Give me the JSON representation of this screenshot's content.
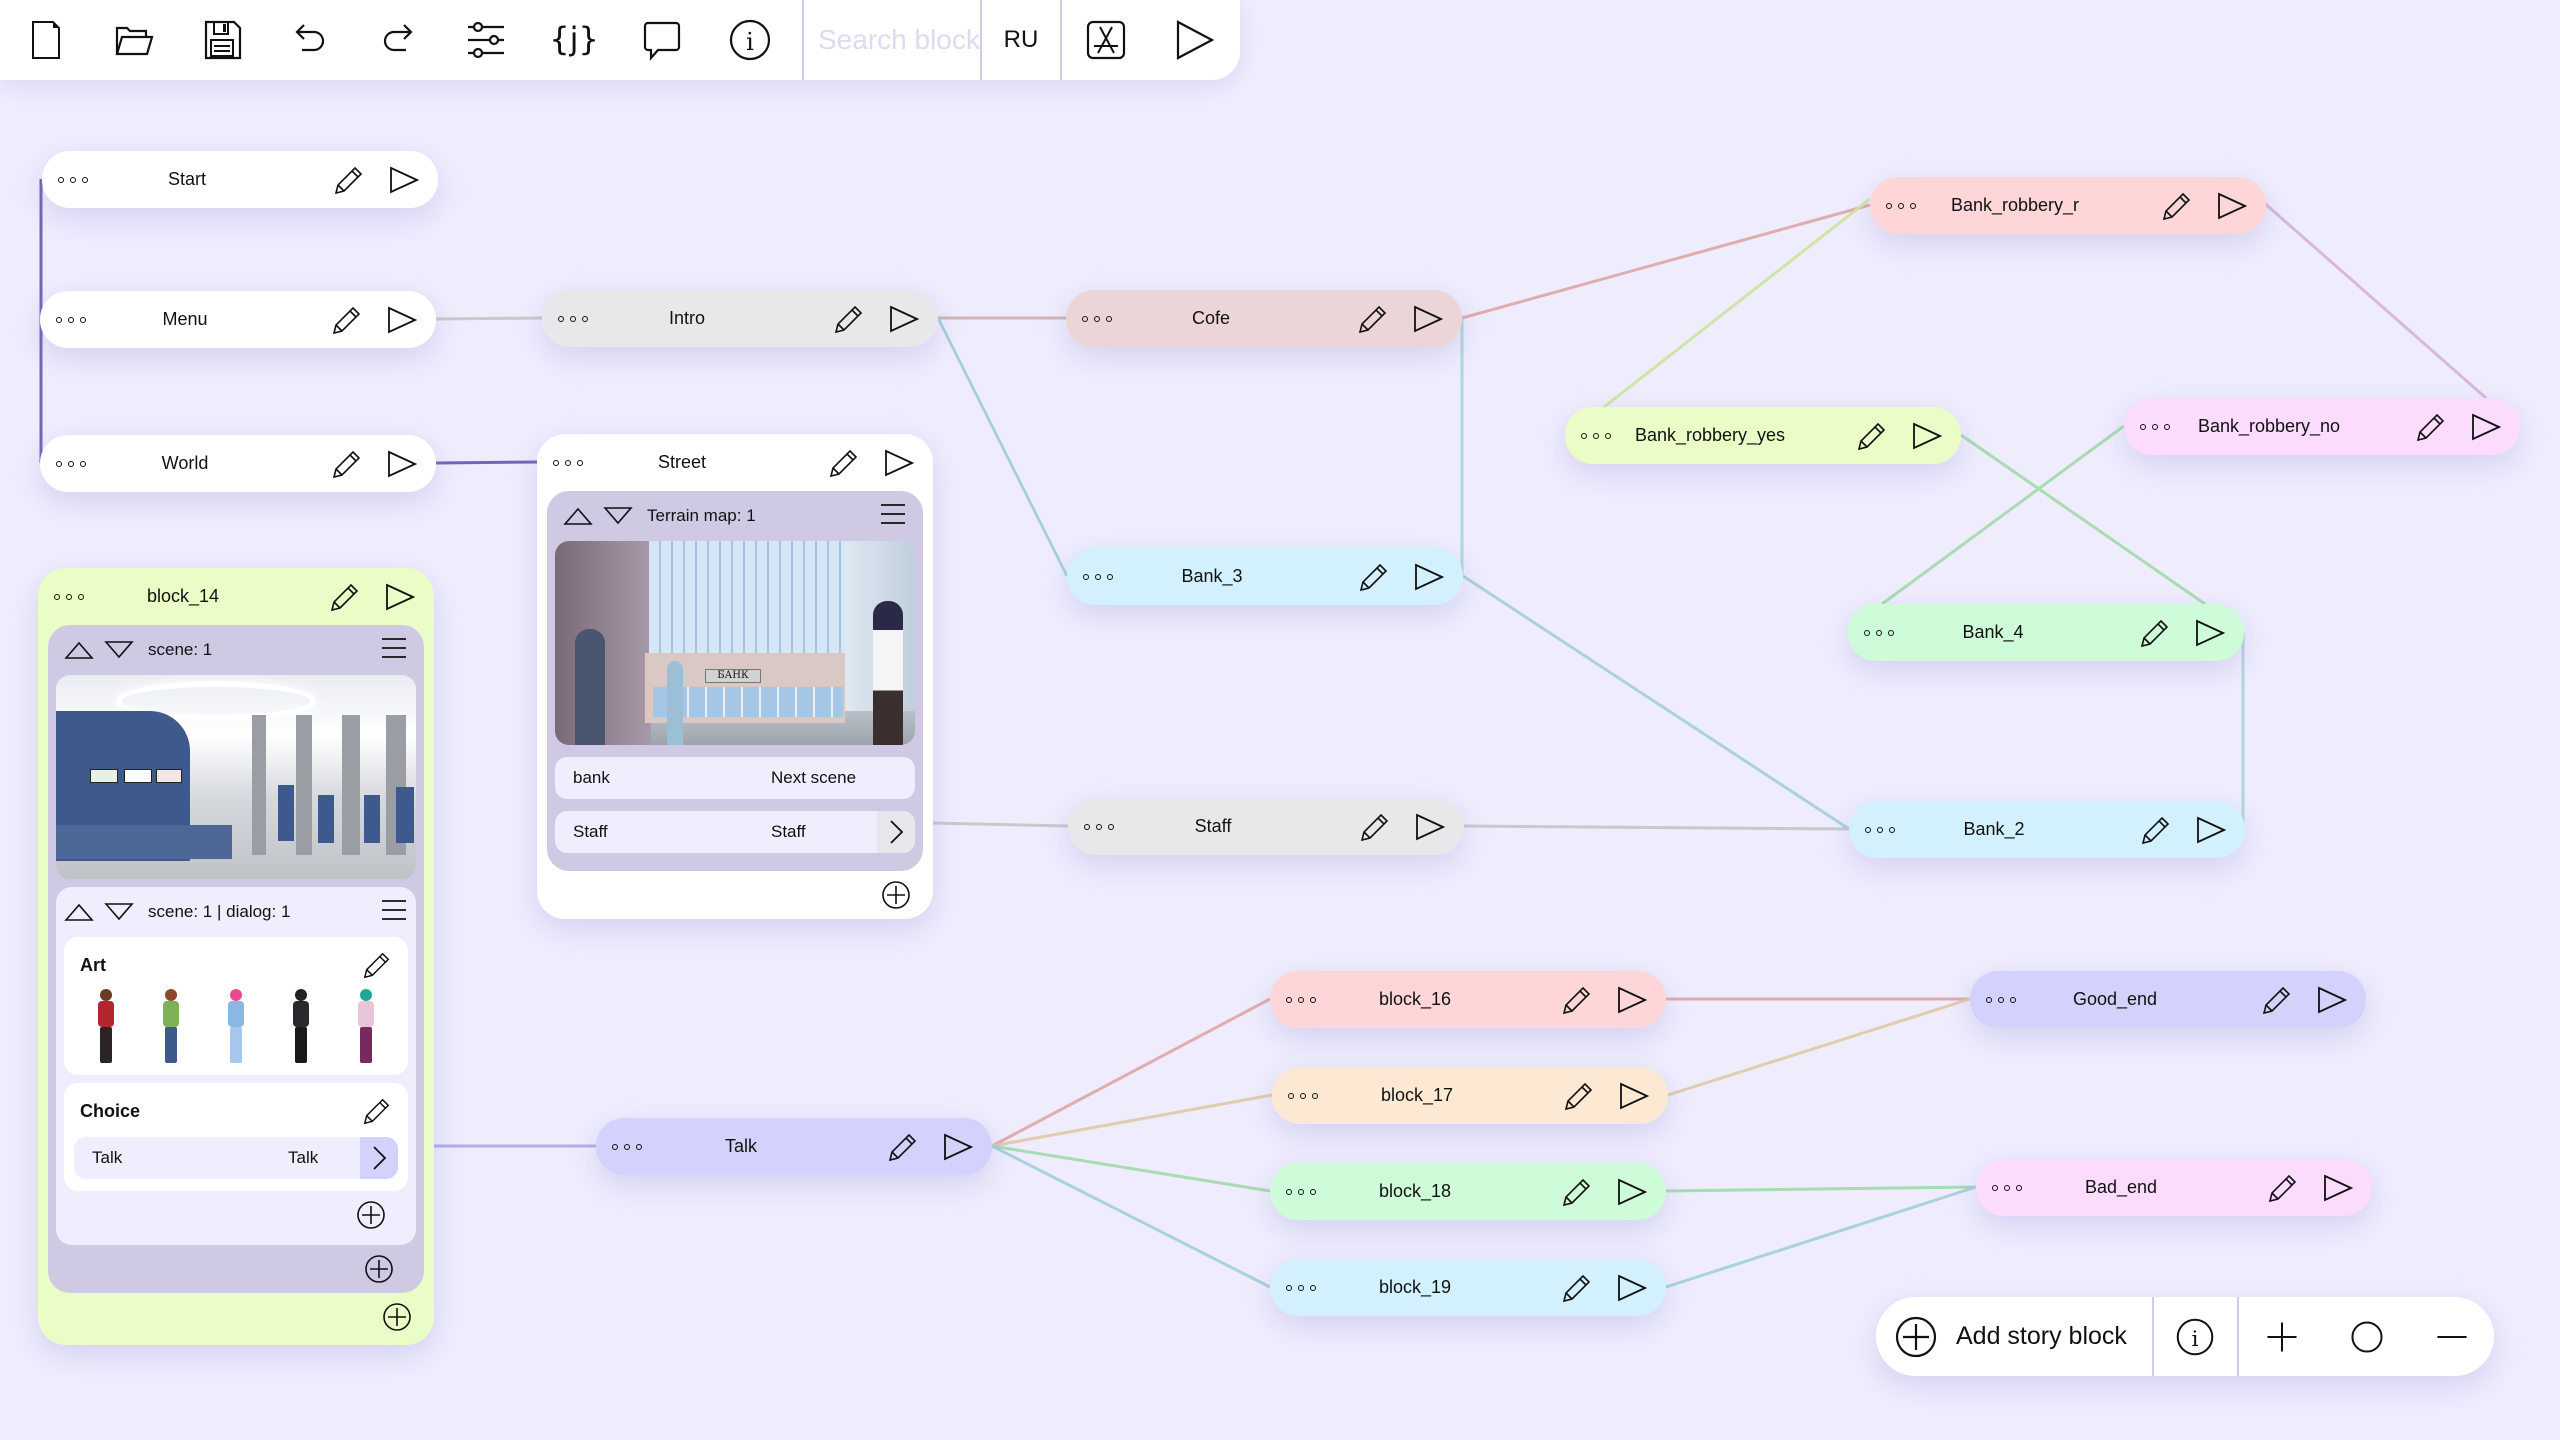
{
  "toolbar": {
    "icons": [
      "new-file-icon",
      "open-folder-icon",
      "save-icon",
      "undo-icon",
      "redo-icon",
      "settings-sliders-icon",
      "variables-icon",
      "comment-icon",
      "info-icon"
    ],
    "search_placeholder": "Search block",
    "language": "RU",
    "build_icon": "app-store-icon",
    "play_icon": "play-icon"
  },
  "blocks": {
    "start": {
      "title": "Start"
    },
    "menu": {
      "title": "Menu"
    },
    "world": {
      "title": "World"
    },
    "intro": {
      "title": "Intro"
    },
    "street": {
      "title": "Street",
      "panel_label": "Terrain map: 1",
      "image": "street-bank-scene",
      "rows": [
        {
          "left": "bank",
          "right": "Next scene"
        },
        {
          "left": "Staff",
          "right": "Staff"
        }
      ]
    },
    "block_14": {
      "title": "block_14",
      "scene_label": "scene: 1",
      "image": "bank-interior-scene",
      "dialog_label": "scene: 1 | dialog: 1",
      "art_title": "Art",
      "characters": [
        "man-red-shirt",
        "woman-green-top",
        "woman-pink-hair",
        "man-black-suit",
        "woman-teal-hair"
      ],
      "choice_title": "Choice",
      "choice_row": {
        "left": "Talk",
        "right": "Talk"
      }
    },
    "cofe": {
      "title": "Cofe"
    },
    "bank_3": {
      "title": "Bank_3"
    },
    "staff": {
      "title": "Staff"
    },
    "bank_robbery_r": {
      "title": "Bank_robbery_r"
    },
    "bank_robbery_yes": {
      "title": "Bank_robbery_yes"
    },
    "bank_robbery_no": {
      "title": "Bank_robbery_no"
    },
    "bank_4": {
      "title": "Bank_4"
    },
    "bank_2": {
      "title": "Bank_2"
    },
    "talk": {
      "title": "Talk"
    },
    "block_16": {
      "title": "block_16"
    },
    "block_17": {
      "title": "block_17"
    },
    "block_18": {
      "title": "block_18"
    },
    "block_19": {
      "title": "block_19"
    },
    "good_end": {
      "title": "Good_end"
    },
    "bad_end": {
      "title": "Bad_end"
    }
  },
  "connections": [
    {
      "from": "start",
      "to": "menu",
      "color": "#7366b8"
    },
    {
      "from": "menu",
      "to": "world",
      "color": "#7366b8"
    },
    {
      "from": "menu",
      "to": "intro",
      "color": "#c9c9cc"
    },
    {
      "from": "world",
      "to": "street",
      "color": "#7366b8"
    },
    {
      "from": "intro",
      "to": "cofe",
      "color": "#d4b4b6"
    },
    {
      "from": "intro",
      "to": "bank_3",
      "color": "#a8d2dc"
    },
    {
      "from": "cofe",
      "to": "bank_robbery_r",
      "color": "#e0acae"
    },
    {
      "from": "cofe",
      "to": "bank_3",
      "color": "#b2d6e0"
    },
    {
      "from": "bank_robbery_r",
      "to": "bank_robbery_yes",
      "color": "#cde6a6"
    },
    {
      "from": "bank_robbery_r",
      "to": "bank_robbery_no",
      "color": "#d8b8dc"
    },
    {
      "from": "bank_robbery_yes",
      "to": "bank_4",
      "color": "#a8dcb2"
    },
    {
      "from": "bank_robbery_no",
      "to": "bank_4",
      "color": "#a8dcb2"
    },
    {
      "from": "bank_4",
      "to": "bank_2",
      "color": "#b2d6e0"
    },
    {
      "from": "bank_3",
      "to": "bank_2",
      "color": "#a8d2dc"
    },
    {
      "from": "street",
      "to": "staff",
      "color": "#c9c9cc"
    },
    {
      "from": "staff",
      "to": "bank_2",
      "color": "#c9c9cc"
    },
    {
      "from": "block_14",
      "to": "talk",
      "color": "#b3aee6"
    },
    {
      "from": "talk",
      "to": "block_16",
      "color": "#e0acae"
    },
    {
      "from": "talk",
      "to": "block_17",
      "color": "#e2ccae"
    },
    {
      "from": "talk",
      "to": "block_18",
      "color": "#a8dcb2"
    },
    {
      "from": "talk",
      "to": "block_19",
      "color": "#a8d2dc"
    },
    {
      "from": "block_16",
      "to": "good_end",
      "color": "#e0acae"
    },
    {
      "from": "block_17",
      "to": "good_end",
      "color": "#e2ccae"
    },
    {
      "from": "block_18",
      "to": "bad_end",
      "color": "#a8dcb2"
    },
    {
      "from": "block_19",
      "to": "bad_end",
      "color": "#a8d2dc"
    }
  ],
  "bottombar": {
    "add_label": "Add story block",
    "icons": [
      "add-circle-icon",
      "info-icon",
      "zoom-in-icon",
      "reset-zoom-icon",
      "zoom-out-icon"
    ]
  }
}
